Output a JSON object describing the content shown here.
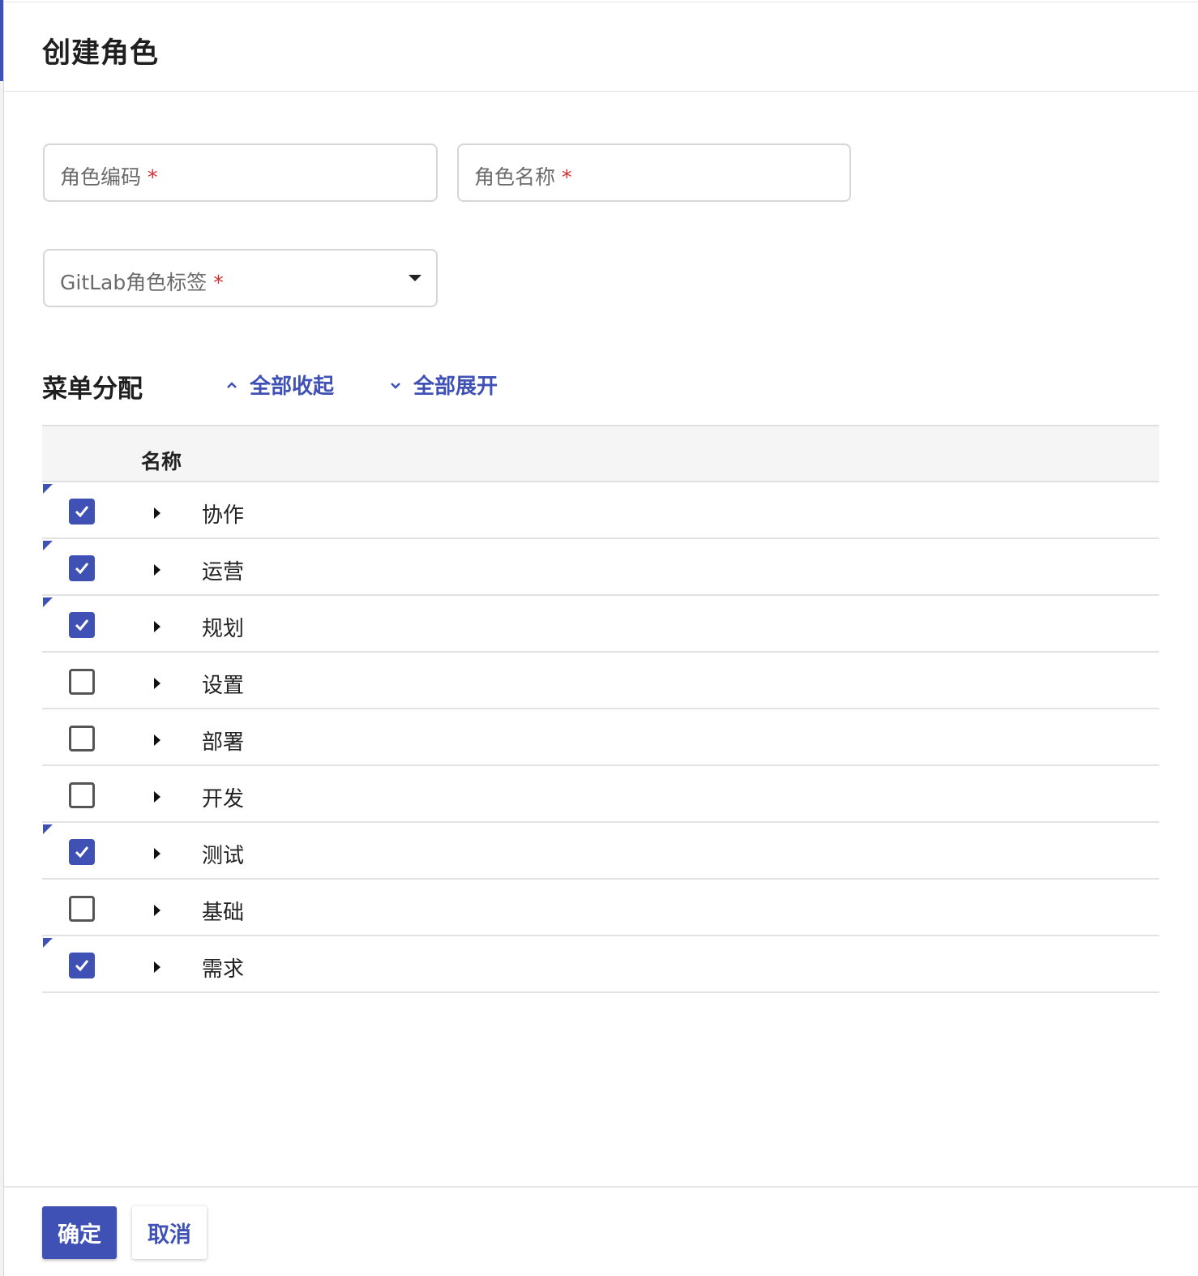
{
  "dialog": {
    "title": "创建角色"
  },
  "form": {
    "role_code": {
      "label": "角色编码",
      "required_mark": "*",
      "value": ""
    },
    "role_name": {
      "label": "角色名称",
      "required_mark": "*",
      "value": ""
    },
    "gitlab_tag": {
      "label": "GitLab角色标签",
      "required_mark": "*",
      "value": ""
    }
  },
  "menu_section": {
    "title": "菜单分配",
    "collapse_all": "全部收起",
    "expand_all": "全部展开",
    "column_name": "名称",
    "rows": [
      {
        "label": "协作",
        "checked": true
      },
      {
        "label": "运营",
        "checked": true
      },
      {
        "label": "规划",
        "checked": true
      },
      {
        "label": "设置",
        "checked": false
      },
      {
        "label": "部署",
        "checked": false
      },
      {
        "label": "开发",
        "checked": false
      },
      {
        "label": "测试",
        "checked": true
      },
      {
        "label": "基础",
        "checked": false
      },
      {
        "label": "需求",
        "checked": true
      }
    ]
  },
  "footer": {
    "confirm": "确定",
    "cancel": "取消"
  },
  "colors": {
    "accent": "#3f51b5",
    "required": "#d32f2f"
  }
}
